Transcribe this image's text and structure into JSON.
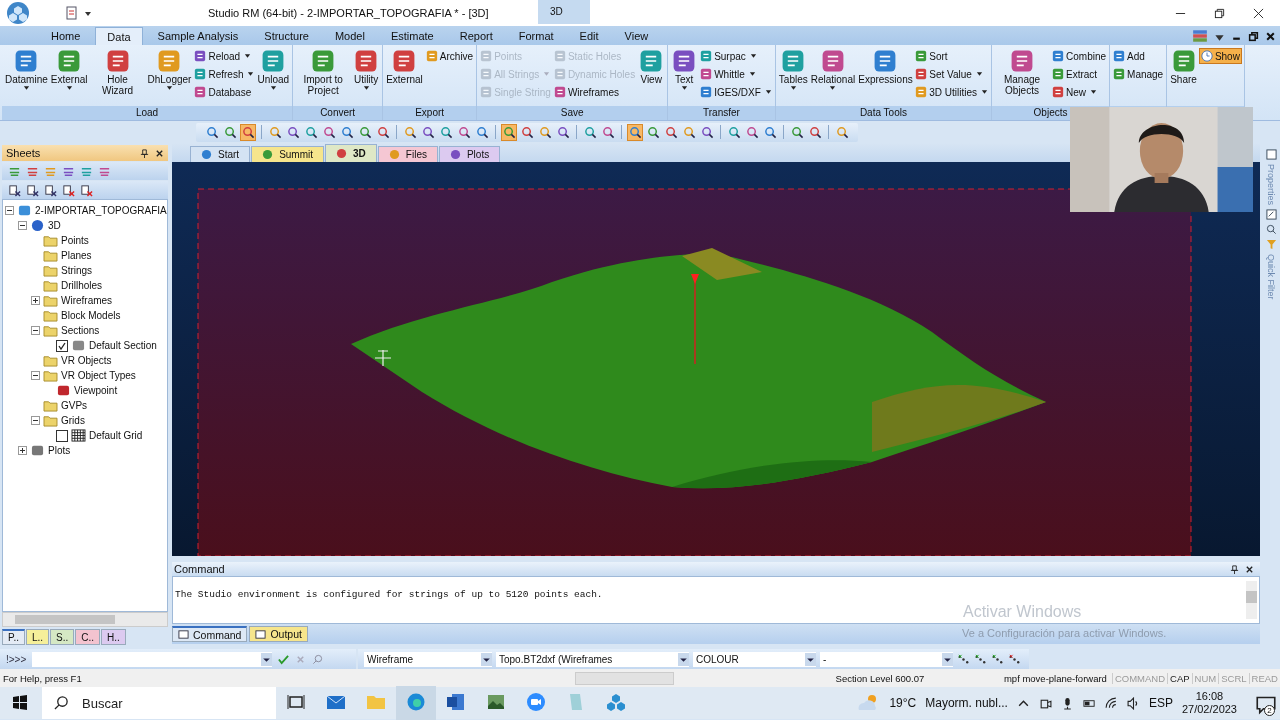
{
  "title_bar": {
    "title": "Studio RM (64-bit) - 2-IMPORTAR_TOPOGRAFIA * - [3D]",
    "context_tab": "3D"
  },
  "menu_tabs": [
    {
      "label": "Home",
      "selected": false
    },
    {
      "label": "Data",
      "selected": true
    },
    {
      "label": "Sample Analysis",
      "selected": false
    },
    {
      "label": "Structure",
      "selected": false
    },
    {
      "label": "Model",
      "selected": false
    },
    {
      "label": "Estimate",
      "selected": false
    },
    {
      "label": "Report",
      "selected": false
    },
    {
      "label": "Format",
      "selected": false
    },
    {
      "label": "Edit",
      "selected": false
    },
    {
      "label": "View",
      "selected": false
    }
  ],
  "ribbon": [
    {
      "label": "Load",
      "columns": [
        {
          "kind": "large",
          "label": "Datamine",
          "menu": true
        },
        {
          "kind": "large",
          "label": "External",
          "menu": true
        },
        {
          "kind": "large",
          "label": "Hole Wizard",
          "menu": false
        },
        {
          "kind": "large",
          "label": "DhLogger",
          "menu": true
        },
        {
          "kind": "stack",
          "items": [
            {
              "kind": "small",
              "label": "Reload",
              "menu": true,
              "disabled": false
            },
            {
              "kind": "small",
              "label": "Refresh",
              "menu": true,
              "disabled": false
            },
            {
              "kind": "small",
              "label": "Database",
              "menu": false,
              "disabled": false
            }
          ]
        },
        {
          "kind": "large",
          "label": "Unload",
          "menu": true
        }
      ]
    },
    {
      "label": "Convert",
      "columns": [
        {
          "kind": "large",
          "label": "Import to Project",
          "menu": false
        },
        {
          "kind": "large",
          "label": "Utility",
          "menu": true
        }
      ]
    },
    {
      "label": "Export",
      "columns": [
        {
          "kind": "large",
          "label": "External",
          "menu": false
        },
        {
          "kind": "stack",
          "items": [
            {
              "kind": "small",
              "label": "Archive",
              "menu": false,
              "disabled": false
            }
          ]
        }
      ]
    },
    {
      "label": "Save",
      "columns": [
        {
          "kind": "stack",
          "items": [
            {
              "kind": "small",
              "label": "Points",
              "menu": false,
              "disabled": true
            },
            {
              "kind": "small",
              "label": "All Strings",
              "menu": true,
              "disabled": true
            },
            {
              "kind": "small",
              "label": "Single String",
              "menu": false,
              "disabled": true
            }
          ]
        },
        {
          "kind": "stack",
          "items": [
            {
              "kind": "small",
              "label": "Static Holes",
              "menu": false,
              "disabled": true
            },
            {
              "kind": "small",
              "label": "Dynamic Holes",
              "menu": false,
              "disabled": true
            },
            {
              "kind": "small",
              "label": "Wireframes",
              "menu": false,
              "disabled": false
            }
          ]
        },
        {
          "kind": "large",
          "label": "View",
          "menu": false
        }
      ]
    },
    {
      "label": "Transfer",
      "columns": [
        {
          "kind": "large",
          "label": "Text",
          "menu": true
        },
        {
          "kind": "stack",
          "items": [
            {
              "kind": "small",
              "label": "Surpac",
              "menu": true,
              "disabled": false
            },
            {
              "kind": "small",
              "label": "Whittle",
              "menu": true,
              "disabled": false
            },
            {
              "kind": "small",
              "label": "IGES/DXF",
              "menu": true,
              "disabled": false
            }
          ]
        }
      ]
    },
    {
      "label": "Data Tools",
      "columns": [
        {
          "kind": "large",
          "label": "Tables",
          "menu": true
        },
        {
          "kind": "large",
          "label": "Relational",
          "menu": true
        },
        {
          "kind": "large",
          "label": "Expressions",
          "menu": false
        },
        {
          "kind": "stack",
          "items": [
            {
              "kind": "small",
              "label": "Sort",
              "menu": false,
              "disabled": false
            },
            {
              "kind": "small",
              "label": "Set Value",
              "menu": true,
              "disabled": false
            },
            {
              "kind": "small",
              "label": "3D Utilities",
              "menu": true,
              "disabled": false
            }
          ]
        }
      ]
    },
    {
      "label": "Objects",
      "columns": [
        {
          "kind": "large",
          "label": "Manage Objects",
          "menu": false
        },
        {
          "kind": "stack",
          "items": [
            {
              "kind": "small",
              "label": "Combine",
              "menu": false,
              "disabled": false
            },
            {
              "kind": "small",
              "label": "Extract",
              "menu": false,
              "disabled": false
            },
            {
              "kind": "small",
              "label": "New",
              "menu": true,
              "disabled": false
            }
          ]
        }
      ]
    },
    {
      "columns": [
        {
          "kind": "stack",
          "items": [
            {
              "kind": "small",
              "label": "Add",
              "menu": false,
              "disabled": false
            },
            {
              "kind": "small",
              "label": "Manage",
              "menu": false,
              "disabled": false
            }
          ]
        }
      ]
    },
    {
      "columns": [
        {
          "kind": "large",
          "label": "Share",
          "menu": false
        },
        {
          "kind": "stack",
          "items": [
            {
              "kind": "toggle",
              "label": "Show",
              "selected": true
            }
          ]
        }
      ]
    }
  ],
  "toolbar": [
    {
      "on": false
    },
    {
      "on": false
    },
    {
      "on": true
    },
    {
      "on": false
    },
    {
      "on": false
    },
    {
      "on": false
    },
    {
      "on": false
    },
    {
      "on": false
    },
    {
      "on": false
    },
    {
      "on": false
    },
    {
      "on": false
    },
    {
      "on": false
    },
    {
      "on": false
    },
    {
      "on": false
    },
    {
      "on": false
    },
    {
      "on": true
    },
    {
      "on": false
    },
    {
      "on": false
    },
    {
      "on": false
    },
    {
      "on": false
    },
    {
      "on": false
    },
    {
      "on": true
    },
    {
      "on": false
    },
    {
      "on": false
    },
    {
      "on": false
    },
    {
      "on": false
    },
    {
      "on": false
    },
    {
      "on": false
    },
    {
      "on": false
    },
    {
      "on": false
    },
    {
      "on": false
    },
    {
      "on": false
    }
  ],
  "sheets": {
    "title": "Sheets",
    "tree": [
      {
        "label": "2-IMPORTAR_TOPOGRAFIA",
        "kind": "project",
        "expanded": true,
        "children": [
          {
            "label": "3D",
            "kind": "scene",
            "expanded": true,
            "children": [
              {
                "label": "Points",
                "kind": "folder"
              },
              {
                "label": "Planes",
                "kind": "folder"
              },
              {
                "label": "Strings",
                "kind": "folder"
              },
              {
                "label": "Drillholes",
                "kind": "folder"
              },
              {
                "label": "Wireframes",
                "kind": "folder",
                "expanded": false
              },
              {
                "label": "Block Models",
                "kind": "folder"
              },
              {
                "label": "Sections",
                "kind": "folder",
                "expanded": true,
                "children": [
                  {
                    "label": "Default Section",
                    "kind": "section",
                    "checked": true
                  }
                ]
              },
              {
                "label": "VR Objects",
                "kind": "folder"
              },
              {
                "label": "VR Object Types",
                "kind": "folder",
                "expanded": true,
                "children": [
                  {
                    "label": "Viewpoint",
                    "kind": "viewpoint"
                  }
                ]
              },
              {
                "label": "GVPs",
                "kind": "folder"
              },
              {
                "label": "Grids",
                "kind": "folder",
                "expanded": true,
                "children": [
                  {
                    "label": "Default Grid",
                    "kind": "grid",
                    "checked": false
                  }
                ]
              }
            ]
          },
          {
            "label": "Plots",
            "kind": "plots",
            "expanded": false
          }
        ]
      }
    ],
    "tabs": [
      {
        "label": "P..",
        "color": "#e4ebf5",
        "selected": true
      },
      {
        "label": "L..",
        "color": "#f5ef9a",
        "selected": false
      },
      {
        "label": "S..",
        "color": "#d5e8c4",
        "selected": false
      },
      {
        "label": "C..",
        "color": "#f3c3cf",
        "selected": false
      },
      {
        "label": "H..",
        "color": "#dccaf0",
        "selected": false
      }
    ]
  },
  "doc_tabs": [
    {
      "label": "Start",
      "color": "#d4e3f3",
      "selected": false
    },
    {
      "label": "Summit",
      "color": "#f6e58c",
      "selected": false
    },
    {
      "label": "3D",
      "color": "#dfe8c6",
      "selected": true
    },
    {
      "label": "Files",
      "color": "#f5c7d3",
      "selected": false
    },
    {
      "label": "Plots",
      "color": "#dccaf0",
      "selected": false
    }
  ],
  "side_tabs": [
    {
      "label": "Properties"
    },
    {
      "label": "Quick Filter"
    }
  ],
  "command_panel": {
    "title": "Command",
    "output": "The Studio environment is configured for strings of up to 5120 points each.",
    "tabs": [
      {
        "label": "Command",
        "color": "#dde8f5",
        "selected": true
      },
      {
        "label": "Output",
        "color": "#f6e58c",
        "selected": false
      }
    ]
  },
  "activation": {
    "title": "Activar Windows",
    "subtitle": "Ve a Configuración para activar Windows."
  },
  "command_bar": {
    "prompt": "!>>>",
    "dropdowns": [
      "Wireframe",
      "Topo.BT2dxf (Wireframes",
      "COLOUR",
      "-"
    ]
  },
  "status_bar": {
    "help": "For Help, press F1",
    "section_level": "Section Level 600.07",
    "command": "mpf move-plane-forward",
    "indicators": [
      {
        "label": "COMMAND",
        "on": false
      },
      {
        "label": "CAP",
        "on": true
      },
      {
        "label": "NUM",
        "on": false
      },
      {
        "label": "SCRL",
        "on": false
      },
      {
        "label": "READ",
        "on": false
      }
    ]
  },
  "taskbar": {
    "search_placeholder": "Buscar",
    "temperature": "19°C",
    "weather": "Mayorm. nubl...",
    "language": "ESP",
    "time": "16:08",
    "date": "27/02/2023",
    "notifications": "2"
  }
}
